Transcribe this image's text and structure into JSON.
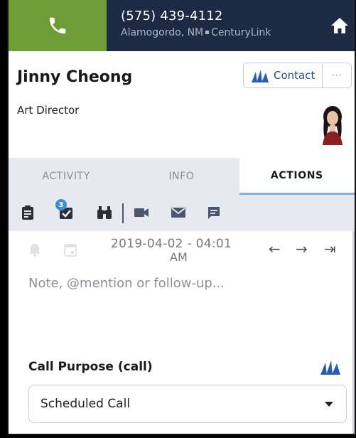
{
  "header": {
    "phone_number": "(575) 439-4112",
    "location": "Alamogordo, NM",
    "carrier": "CenturyLink",
    "call_icon": "phone-icon",
    "home_icon": "home-icon",
    "call_color": "#6e9d35",
    "bg_color": "#1d2a44"
  },
  "contact": {
    "name": "Jinny Cheong",
    "title": "Art Director",
    "contact_button_label": "Contact",
    "more_button_label": "···",
    "crm_icon": "dynamics-logo-icon"
  },
  "tabs": [
    {
      "label": "ACTIVITY",
      "active": false
    },
    {
      "label": "INFO",
      "active": false
    },
    {
      "label": "ACTIONS",
      "active": true
    }
  ],
  "toolbar": {
    "icons": [
      "clipboard-icon",
      "task-check-icon",
      "binoculars-icon",
      "video-icon",
      "mail-icon",
      "chat-icon"
    ],
    "task_badge_count": "3"
  },
  "note": {
    "date_line1": "2019-04-02 - 04:01",
    "date_line2": "AM",
    "placeholder": "Note, @mention or follow-up..."
  },
  "call_purpose": {
    "label": "Call Purpose (call)",
    "selected": "Scheduled Call"
  }
}
